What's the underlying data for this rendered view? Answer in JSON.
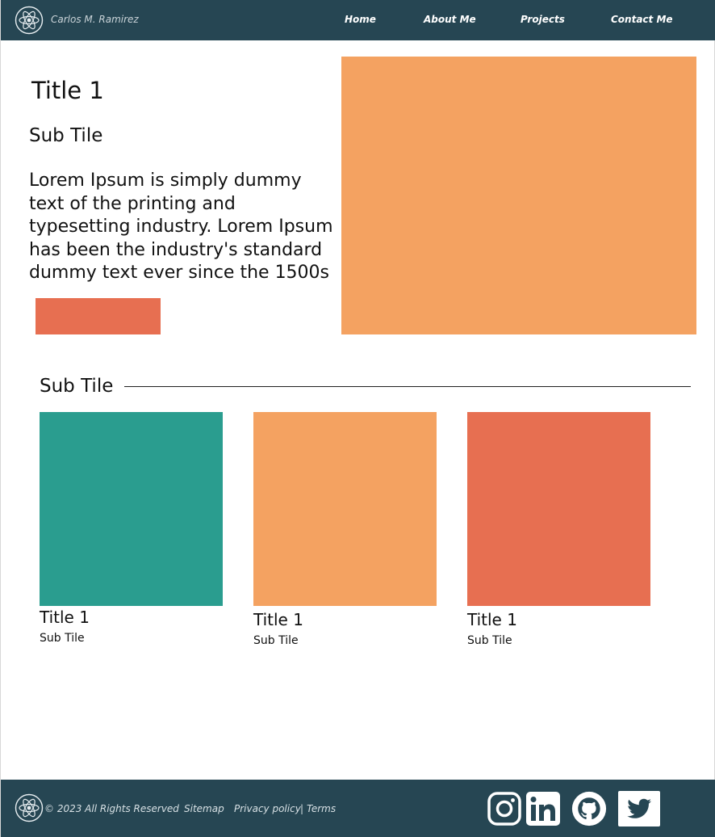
{
  "header": {
    "brand": "Carlos M. Ramirez",
    "nav": [
      "Home",
      "About Me",
      "Projects",
      "Contact Me"
    ]
  },
  "hero": {
    "title": "Title 1",
    "subtitle": "Sub Tile",
    "body": "Lorem Ipsum is simply dummy text of the printing and typesetting industry. Lorem Ipsum has been the industry's standard dummy text ever since the 1500s"
  },
  "section": {
    "title": "Sub Tile",
    "cards": [
      {
        "title": "Title 1",
        "subtitle": "Sub Tile",
        "color": "#2a9d8f"
      },
      {
        "title": "Title 1",
        "subtitle": "Sub Tile",
        "color": "#f4a261"
      },
      {
        "title": "Title 1",
        "subtitle": "Sub Tile",
        "color": "#e76f51"
      }
    ]
  },
  "footer": {
    "copyright": "© 2023 All Rights Reserved",
    "sitemap": "Sitemap",
    "privacy": "Privacy policy",
    "separator": "|",
    "terms": "Terms",
    "social_icons": [
      "instagram-icon",
      "linkedin-icon",
      "github-icon",
      "twitter-icon"
    ]
  },
  "colors": {
    "navy": "#264653",
    "teal": "#2a9d8f",
    "sand": "#f4a261",
    "coral": "#e76f51"
  }
}
